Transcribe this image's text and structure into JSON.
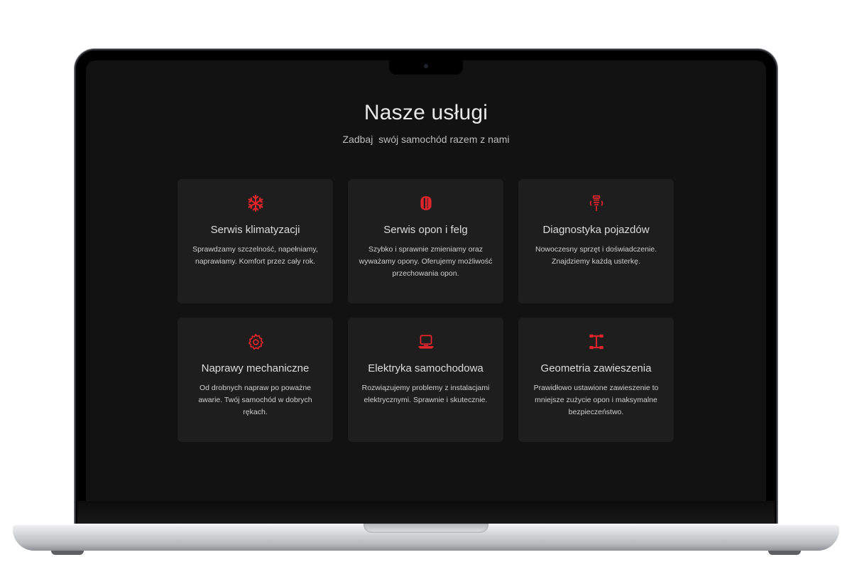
{
  "section": {
    "title": "Nasze usługi",
    "subtitle": "Zadbaj  swój samochód razem z nami"
  },
  "colors": {
    "accent": "#e0242b",
    "screen_bg": "#121212",
    "card_bg": "#1e1e1f"
  },
  "services": [
    {
      "icon": "snowflake-icon",
      "title": "Serwis klimatyzacji",
      "description": "Sprawdzamy szczelność, napełniamy, naprawiamy. Komfort przez cały rok."
    },
    {
      "icon": "tire-icon",
      "title": "Serwis opon i felg",
      "description": "Szybko i sprawnie zmieniamy oraz wyważamy opony. Oferujemy możliwość przechowania opon."
    },
    {
      "icon": "diagnostics-icon",
      "title": "Diagnostyka pojazdów",
      "description": "Nowoczesny sprzęt i  doświadczenie. Znajdziemy każdą usterkę."
    },
    {
      "icon": "gear-icon",
      "title": "Naprawy mechaniczne",
      "description": "Od drobnych napraw po poważne awarie. Twój samochód w dobrych rękach."
    },
    {
      "icon": "laptop-icon",
      "title": "Elektryka samochodowa",
      "description": "Rozwiązujemy problemy z instalacjami elektrycznymi. Sprawnie i skutecznie."
    },
    {
      "icon": "suspension-icon",
      "title": "Geometria zawieszenia",
      "description": "Prawidłowo ustawione zawieszenie to mniejsze zużycie opon i maksymalne bezpieczeństwo."
    }
  ]
}
